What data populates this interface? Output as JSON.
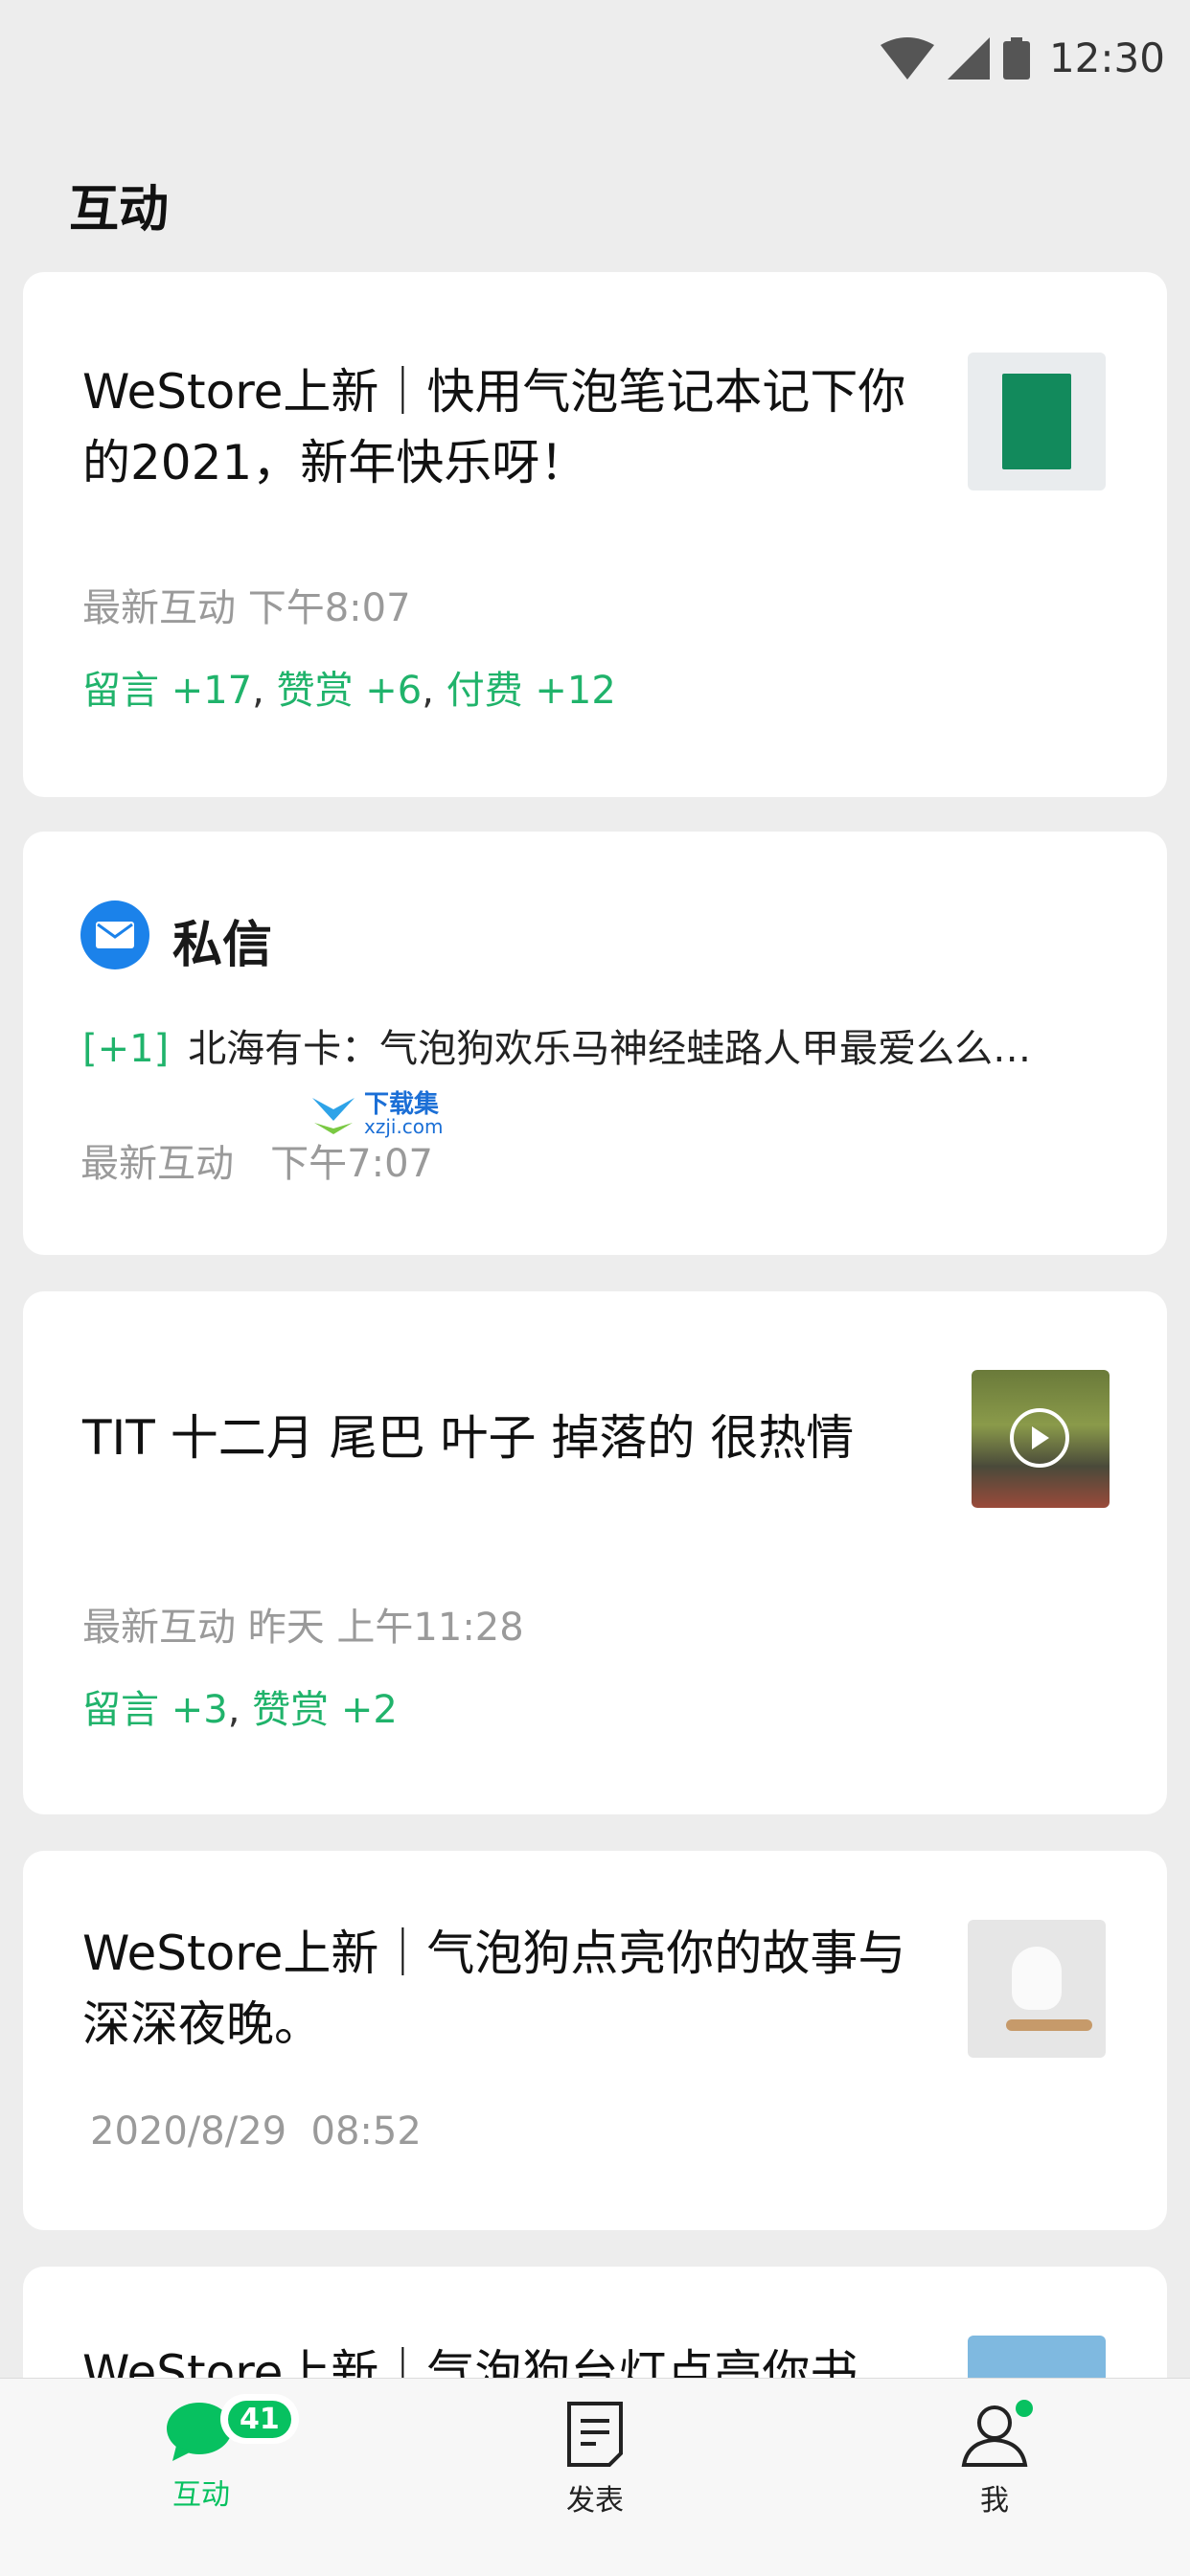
{
  "status_bar": {
    "time": "12:30"
  },
  "page_title": "互动",
  "cards": [
    {
      "title": "WeStore上新｜快用气泡笔记本记下你的2021，新年快乐呀！",
      "meta": "最新互动 下午8:07",
      "stats": [
        {
          "label": "留言 +17"
        },
        {
          "label": "赞赏 +6"
        },
        {
          "label": "付费 +12"
        }
      ],
      "thumb_icon": "green-notebook-image"
    },
    {
      "title": "TIT 十二月 尾巴 叶子 掉落的 很热情",
      "meta": "最新互动 昨天 上午11:28",
      "stats": [
        {
          "label": "留言 +3"
        },
        {
          "label": "赞赏 +2"
        }
      ],
      "thumb_icon": "video-thumbnail"
    },
    {
      "title": "WeStore上新｜气泡狗点亮你的故事与深深夜晚。",
      "meta": "2020/8/29  08:52",
      "thumb_icon": "plush-dog-image"
    },
    {
      "title": "WeStore上新｜气泡狗台灯点亮你书",
      "thumb_icon": "sky-image"
    }
  ],
  "private_message": {
    "title": "私信",
    "tag": "[+1]",
    "preview": "北海有卡：气泡狗欢乐马神经蛙路人甲最爱么么…",
    "meta": "最新互动   下午7:07",
    "icon": "mail-icon"
  },
  "watermark": {
    "cn": "下载集",
    "en": "xzji.com"
  },
  "tabbar": {
    "tabs": [
      {
        "label": "互动",
        "badge": "41",
        "icon": "chat-bubble-icon",
        "active": true
      },
      {
        "label": "发表",
        "icon": "document-icon"
      },
      {
        "label": "我",
        "icon": "person-icon"
      }
    ]
  },
  "colors": {
    "accent": "#07c160",
    "stat_green": "#20b36b",
    "mail_blue": "#1b82ea",
    "background": "#ededed"
  }
}
